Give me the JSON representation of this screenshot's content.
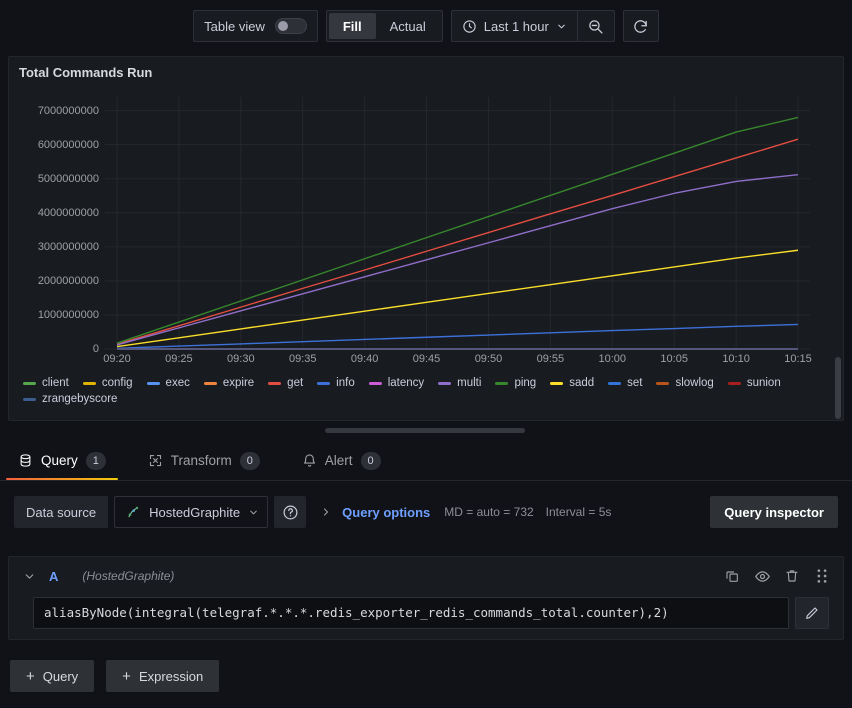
{
  "toolbar": {
    "table_view_label": "Table view",
    "table_view_on": false,
    "fill_label": "Fill",
    "actual_label": "Actual",
    "selected_scale": "Fill",
    "time_range": "Last 1 hour",
    "clock_icon": "clock-icon",
    "chevron_icon": "chevron-down-icon",
    "zoom_out_icon": "zoom-out-icon",
    "refresh_icon": "refresh-icon"
  },
  "panel": {
    "title": "Total Commands Run"
  },
  "chart_data": {
    "type": "line",
    "title": "Total Commands Run",
    "xlabel": "",
    "ylabel": "",
    "grid": true,
    "legend_position": "bottom",
    "ylim": [
      0,
      7400000000
    ],
    "yticks": [
      0,
      1000000000,
      2000000000,
      3000000000,
      4000000000,
      5000000000,
      6000000000,
      7000000000
    ],
    "ytick_labels": [
      "0",
      "1000000000",
      "2000000000",
      "3000000000",
      "4000000000",
      "5000000000",
      "6000000000",
      "7000000000"
    ],
    "x": [
      "09:20",
      "09:25",
      "09:30",
      "09:35",
      "09:40",
      "09:45",
      "09:50",
      "09:55",
      "10:00",
      "10:05",
      "10:10",
      "10:15"
    ],
    "xlim_start": "09:17",
    "xlim_end": "10:17",
    "series": [
      {
        "name": "client",
        "color": "#56a64b",
        "values": [
          0,
          0,
          0,
          0,
          0,
          0,
          0,
          0,
          0,
          0,
          0,
          0
        ]
      },
      {
        "name": "config",
        "color": "#e0b400",
        "values": [
          0,
          0,
          0,
          0,
          0,
          0,
          0,
          0,
          0,
          0,
          0,
          0
        ]
      },
      {
        "name": "exec",
        "color": "#5794f2",
        "values": [
          0,
          0,
          0,
          0,
          0,
          0,
          0,
          0,
          0,
          0,
          0,
          0
        ]
      },
      {
        "name": "expire",
        "color": "#ef843c",
        "values": [
          0,
          0,
          0,
          0,
          0,
          0,
          0,
          0,
          0,
          0,
          0,
          0
        ]
      },
      {
        "name": "get",
        "color": "#e24d42",
        "values": [
          140000000,
          680000000,
          1230000000,
          1780000000,
          2320000000,
          2870000000,
          3420000000,
          3970000000,
          4510000000,
          5060000000,
          5610000000,
          6160000000
        ]
      },
      {
        "name": "info",
        "color": "#3d71d9",
        "values": [
          20000000,
          85000000,
          150000000,
          215000000,
          280000000,
          345000000,
          410000000,
          475000000,
          540000000,
          600000000,
          665000000,
          720000000
        ]
      },
      {
        "name": "latency",
        "color": "#cc5cd6",
        "values": [
          0,
          0,
          0,
          0,
          0,
          0,
          0,
          0,
          0,
          0,
          0,
          0
        ]
      },
      {
        "name": "multi",
        "color": "#8f6ec9",
        "values": [
          120000000,
          620000000,
          1120000000,
          1620000000,
          2120000000,
          2620000000,
          3120000000,
          3620000000,
          4120000000,
          4570000000,
          4920000000,
          5120000000
        ]
      },
      {
        "name": "ping",
        "color": "#37872d",
        "values": [
          170000000,
          790000000,
          1410000000,
          2030000000,
          2650000000,
          3270000000,
          3890000000,
          4510000000,
          5130000000,
          5750000000,
          6370000000,
          6800000000
        ]
      },
      {
        "name": "sadd",
        "color": "#fade2a",
        "values": [
          70000000,
          330000000,
          590000000,
          850000000,
          1110000000,
          1370000000,
          1630000000,
          1890000000,
          2150000000,
          2410000000,
          2670000000,
          2900000000
        ]
      },
      {
        "name": "set",
        "color": "#3274d9",
        "values": [
          0,
          0,
          0,
          0,
          0,
          0,
          0,
          0,
          0,
          0,
          0,
          0
        ]
      },
      {
        "name": "slowlog",
        "color": "#b9531d",
        "values": [
          0,
          0,
          0,
          0,
          0,
          0,
          0,
          0,
          0,
          0,
          0,
          0
        ]
      },
      {
        "name": "sunion",
        "color": "#a71f1f",
        "values": [
          0,
          0,
          0,
          0,
          0,
          0,
          0,
          0,
          0,
          0,
          0,
          0
        ]
      },
      {
        "name": "zrangebyscore",
        "color": "#3c5e8e",
        "values": [
          0,
          0,
          0,
          0,
          0,
          0,
          0,
          0,
          0,
          0,
          0,
          0
        ]
      }
    ]
  },
  "tabs": [
    {
      "label": "Query",
      "count": "1",
      "icon": "database-icon",
      "active": true
    },
    {
      "label": "Transform",
      "count": "0",
      "icon": "transform-icon",
      "active": false
    },
    {
      "label": "Alert",
      "count": "0",
      "icon": "bell-icon",
      "active": false
    }
  ],
  "datasource_row": {
    "label": "Data source",
    "selected": "HostedGraphite",
    "datasource_icon": "graphite-icon",
    "chevron_icon": "chevron-down-icon",
    "help_icon": "question-circle-icon",
    "expand_icon": "chevron-right-icon",
    "query_options_label": "Query options",
    "max_data_points": "MD = auto = 732",
    "interval": "Interval = 5s",
    "query_inspector_label": "Query inspector"
  },
  "query": {
    "ref_id": "A",
    "datasource_note": "(HostedGraphite)",
    "expression": "aliasByNode(integral(telegraf.*.*.*.redis_exporter_redis_commands_total.counter),2)",
    "collapse_icon": "chevron-down-icon",
    "copy_icon": "copy-icon",
    "hide_icon": "eye-icon",
    "delete_icon": "trash-icon",
    "drag_icon": "drag-handle-icon",
    "edit_icon": "pencil-icon"
  },
  "bottom_buttons": [
    {
      "label": "Query",
      "icon": "plus-icon"
    },
    {
      "label": "Expression",
      "icon": "plus-icon"
    }
  ]
}
